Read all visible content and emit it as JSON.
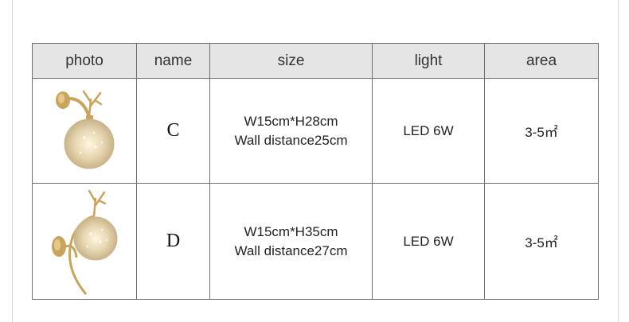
{
  "table": {
    "headers": {
      "photo": "photo",
      "name": "name",
      "size": "size",
      "light": "light",
      "area": "area"
    },
    "rows": [
      {
        "photo_icon": "antler-globe-wall-lamp-short-arm",
        "name": "C",
        "size_line1": "W15cm*H28cm",
        "size_line2": "Wall distance25cm",
        "light": "LED 6W",
        "area": "3-5㎡"
      },
      {
        "photo_icon": "antler-globe-wall-lamp-curved-arm",
        "name": "D",
        "size_line1": "W15cm*H35cm",
        "size_line2": "Wall distance27cm",
        "light": "LED 6W",
        "area": "3-5㎡"
      }
    ]
  },
  "colors": {
    "brass": "#c9a45c",
    "glass": "#e3d4b4",
    "header_bg": "#e5e5e5",
    "border": "#6f6f6f"
  }
}
